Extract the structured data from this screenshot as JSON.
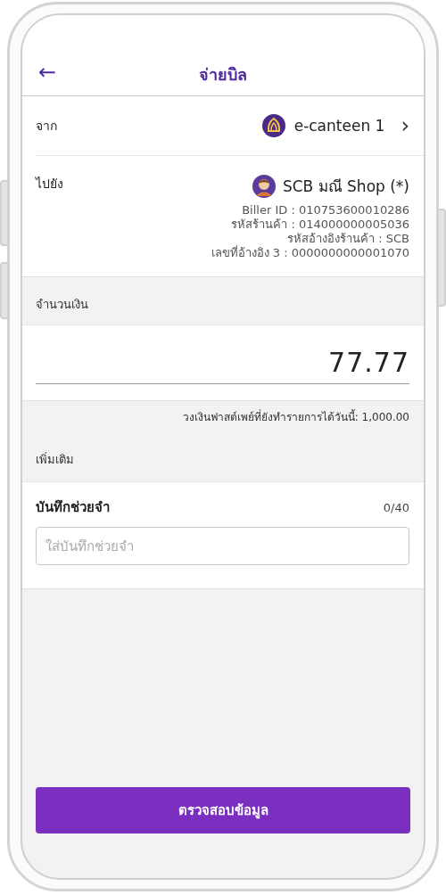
{
  "header": {
    "back": "←",
    "title": "จ่ายบิล"
  },
  "from": {
    "label": "จาก",
    "account": "e-canteen 1",
    "chevron": "›"
  },
  "to": {
    "label": "ไปยัง",
    "name": "SCB มณี Shop (*)",
    "details": [
      "Biller ID : 010753600010286",
      "รหัสร้านค้า : 014000000005036",
      "รหัสอ้างอิงร้านค้า : SCB",
      "เลขที่อ้างอิง 3 : 0000000000001070"
    ]
  },
  "amount": {
    "section": "จำนวนเงิน",
    "value": "77.77",
    "limit": "วงเงินฟาสต์เพย์ที่ยังทำรายการได้วันนี้: 1,000.00"
  },
  "extra": {
    "section": "เพิ่มเติม",
    "memo_label": "บันทึกช่วยจำ",
    "counter": "0/40",
    "placeholder": "ใส่บันทึกช่วยจำ"
  },
  "button": "ตรวจสอบข้อมูล"
}
